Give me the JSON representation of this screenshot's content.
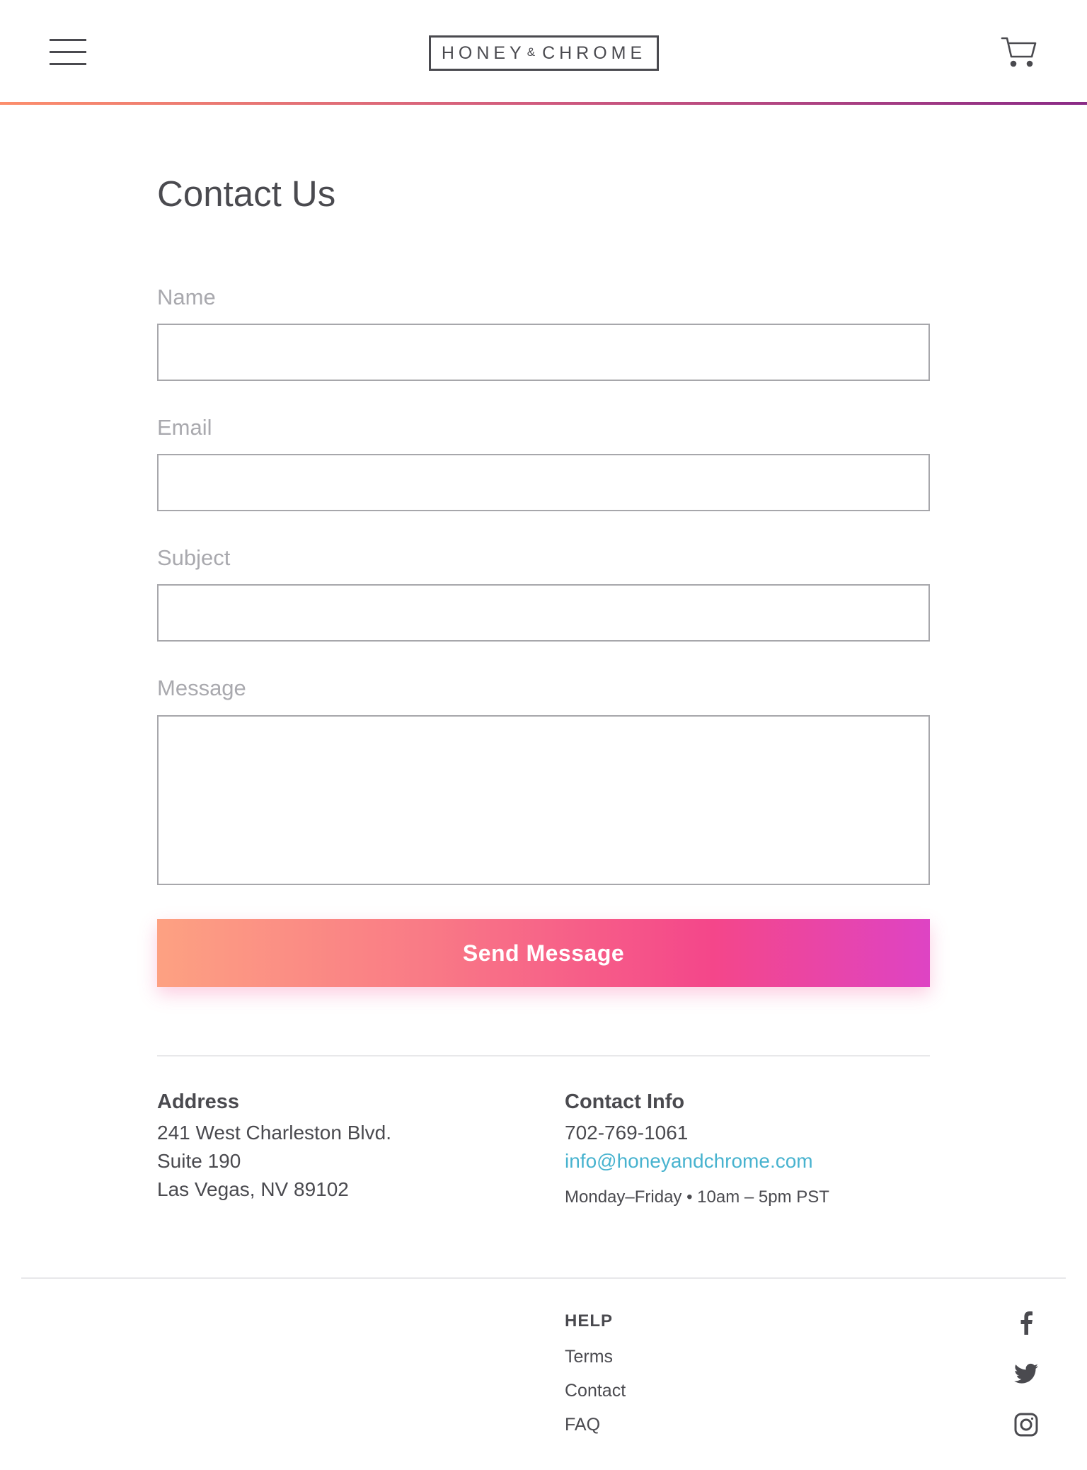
{
  "header": {
    "logo_left": "HONEY",
    "logo_amp": "&",
    "logo_right": "CHROME",
    "menu_icon": "hamburger-menu-icon",
    "cart_icon": "shopping-cart-icon",
    "accent_gradient": [
      "#fc8e6c",
      "#d05a7e",
      "#8a2a86"
    ]
  },
  "page": {
    "title": "Contact Us"
  },
  "form": {
    "name_label": "Name",
    "name_value": "",
    "email_label": "Email",
    "email_value": "",
    "subject_label": "Subject",
    "subject_value": "",
    "message_label": "Message",
    "message_value": "",
    "submit_label": "Send Message",
    "submit_gradient": [
      "#fda182",
      "#f97a86",
      "#f4468a",
      "#de44c4"
    ]
  },
  "address": {
    "heading": "Address",
    "line1": "241 West Charleston Blvd.",
    "line2": "Suite 190",
    "line3": "Las Vegas, NV 89102"
  },
  "contact_info": {
    "heading": "Contact Info",
    "phone": "702-769-1061",
    "email": "info@honeyandchrome.com",
    "hours": "Monday–Friday • 10am – 5pm PST",
    "link_color": "#48b3cf"
  },
  "footer": {
    "help_heading": "HELP",
    "links": [
      "Terms",
      "Contact",
      "FAQ"
    ],
    "social_icons": [
      "facebook-icon",
      "twitter-icon",
      "instagram-icon"
    ]
  }
}
